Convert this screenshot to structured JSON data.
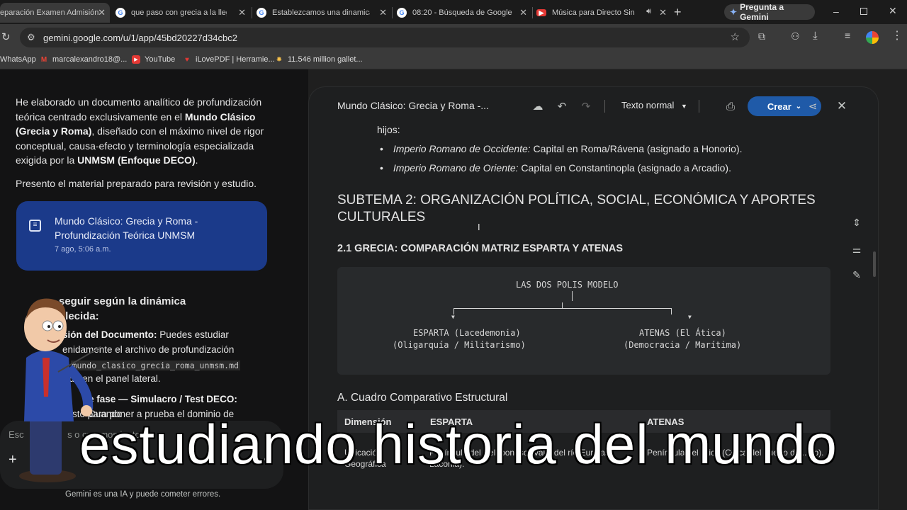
{
  "browser": {
    "tabs": [
      {
        "title": "eparación Examen Admisión",
        "icon": "doc-icon",
        "active": true
      },
      {
        "title": "que paso con grecia a la llega",
        "icon": "google-icon"
      },
      {
        "title": "Establezcamos una dinamica p",
        "icon": "google-icon"
      },
      {
        "title": "08:20 - Búsqueda de Google",
        "icon": "google-icon"
      },
      {
        "title": "Música para Directo Sin C",
        "icon": "youtube-icon"
      }
    ],
    "gemini_button": "Pregunta a Gemini",
    "url": "gemini.google.com/u/1/app/45bd20227d34cbc2",
    "bookmarks": [
      {
        "label": "WhatsApp",
        "icon": "whatsapp-icon"
      },
      {
        "label": "marcalexandro18@...",
        "icon": "gmail-icon"
      },
      {
        "label": "YouTube",
        "icon": "youtube-icon"
      },
      {
        "label": "iLovePDF | Herramie...",
        "icon": "ilovepdf-icon"
      },
      {
        "label": "11.546 million gallet...",
        "icon": "star-icon"
      }
    ]
  },
  "chat": {
    "intro_1": "He elaborado un documento analítico de profundización teórica centrado exclusivamente en el ",
    "intro_bold_1": "Mundo Clásico (Grecia y Roma)",
    "intro_2": ", diseñado con el máximo nivel de rigor conceptual, causa-efecto y terminología especializada exigida por la ",
    "intro_bold_2": "UNMSM (Enfoque DECO)",
    "intro_3": ".",
    "presento": "Presento el material preparado para revisión y estudio.",
    "doc_card": {
      "title": "Mundo Clásico: Grecia y Roma - Profundización Teórica UNMSM",
      "date": "7 ago, 5:06 a.m."
    },
    "next_heading": "seguir según la dinámica",
    "next_heading_2": "blecida:",
    "step1_bold": "sión del Documento:",
    "step1_text": " Puedes estudiar",
    "step1_line2": "enidamente el archivo de profundización",
    "step1_line3a": "rica",
    "step1_code": "mundo_clasico_grecia_roma_unmsm.md",
    "step1_line4": "erado en el panel lateral.",
    "step2_bold": "e fase — Simulacro / Test DECO:",
    "step2_text": " Cuando",
    "step2_line2": "és listo para poner a prueba el dominio de",
    "input_placeholder": "Esc                 s o creemos juntos",
    "footer_note": "Gemini es una IA y puede cometer errores."
  },
  "doc": {
    "title": "Mundo Clásico: Grecia y Roma -...",
    "style_select": "Texto normal",
    "create_label": "Crear",
    "hijos": "hijos:",
    "bullets": [
      {
        "em": "Imperio Romano de Occidente:",
        "text": " Capital en Roma/Rávena (asignado a Honorio)."
      },
      {
        "em": "Imperio Romano de Oriente:",
        "text": " Capital en Constantinopla (asignado a Arcadio)."
      }
    ],
    "subtema": "SUBTEMA 2: ORGANIZACIÓN POLÍTICA, SOCIAL, ECONÓMICA Y APORTES CULTURALES",
    "section_21": "2.1 GRECIA: COMPARACIÓN MATRIZ ESPARTA Y ATENAS",
    "diagram": {
      "root": "LAS DOS POLIS MODELO",
      "left_1": "ESPARTA (Lacedemonia)",
      "left_2": "(Oligarquía / Militarismo)",
      "right_1": "ATENAS (El Ática)",
      "right_2": "(Democracia / Marítima)"
    },
    "section_a": "A. Cuadro Comparativo Estructural",
    "table_headers": [
      "Dimensión",
      "ESPARTA",
      "ATENAS"
    ],
    "table_row": [
      "Ubicación Geográfica",
      "Península del Peloponeso (Valle del río Eurotas, Laconia).",
      "Península del Ática (Cerca del puerto de ...eo)."
    ]
  },
  "caption": "estudiando historia del mundo"
}
